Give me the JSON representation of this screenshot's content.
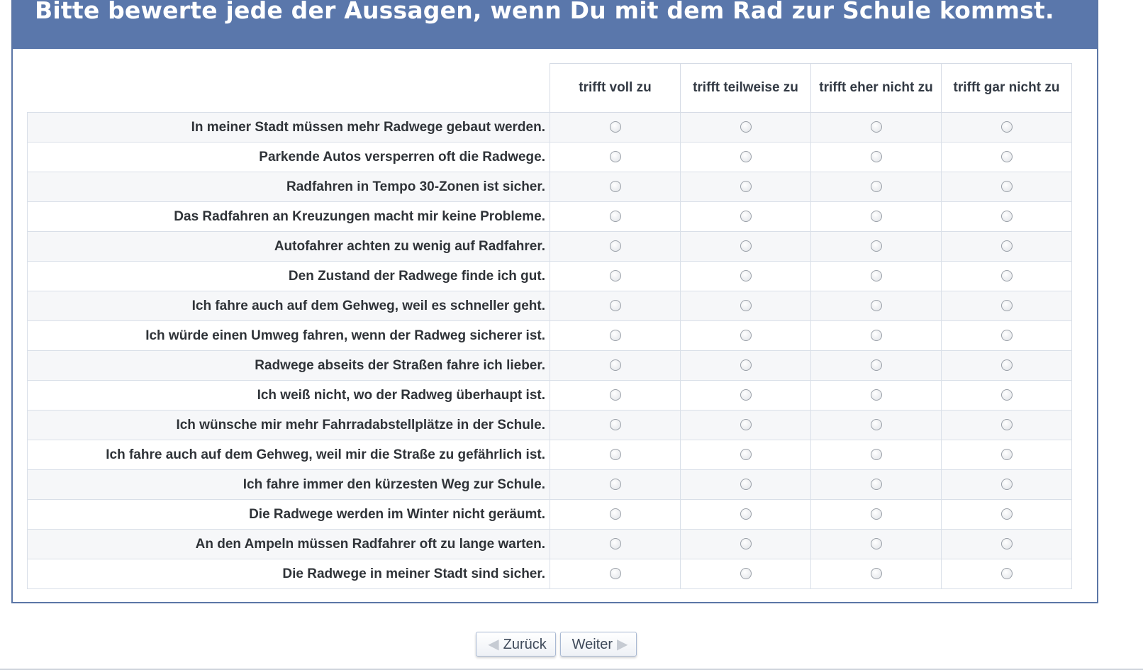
{
  "header": {
    "title": "Bitte bewerte jede der Aussagen, wenn Du mit dem Rad zur Schule kommst."
  },
  "columns": [
    "trifft voll zu",
    "trifft teilweise zu",
    "trifft eher nicht zu",
    "trifft gar nicht zu"
  ],
  "statements": [
    "In meiner Stadt müssen mehr Radwege gebaut werden.",
    "Parkende Autos versperren oft die Radwege.",
    "Radfahren in Tempo 30-Zonen ist sicher.",
    "Das Radfahren an Kreuzungen macht mir keine Probleme.",
    "Autofahrer achten zu wenig auf Radfahrer.",
    "Den Zustand der Radwege finde ich gut.",
    "Ich fahre auch auf dem Gehweg, weil es schneller geht.",
    "Ich würde einen Umweg fahren, wenn der Radweg sicherer ist.",
    "Radwege abseits der Straßen fahre ich lieber.",
    "Ich weiß nicht, wo der Radweg überhaupt ist.",
    "Ich wünsche mir mehr Fahrradabstellplätze in der Schule.",
    "Ich fahre auch auf dem Gehweg, weil mir die Straße zu gefährlich ist.",
    "Ich fahre immer den kürzesten Weg zur Schule.",
    "Die Radwege werden im Winter nicht geräumt.",
    "An den Ampeln müssen Radfahrer oft zu lange warten.",
    "Die Radwege in meiner Stadt sind sicher."
  ],
  "nav": {
    "back_label": "Zurück",
    "next_label": "Weiter",
    "back_icon": "arrow-left-icon",
    "next_icon": "arrow-right-icon"
  },
  "colors": {
    "header_bg": "#5a77ab",
    "border": "#5b76a6"
  }
}
